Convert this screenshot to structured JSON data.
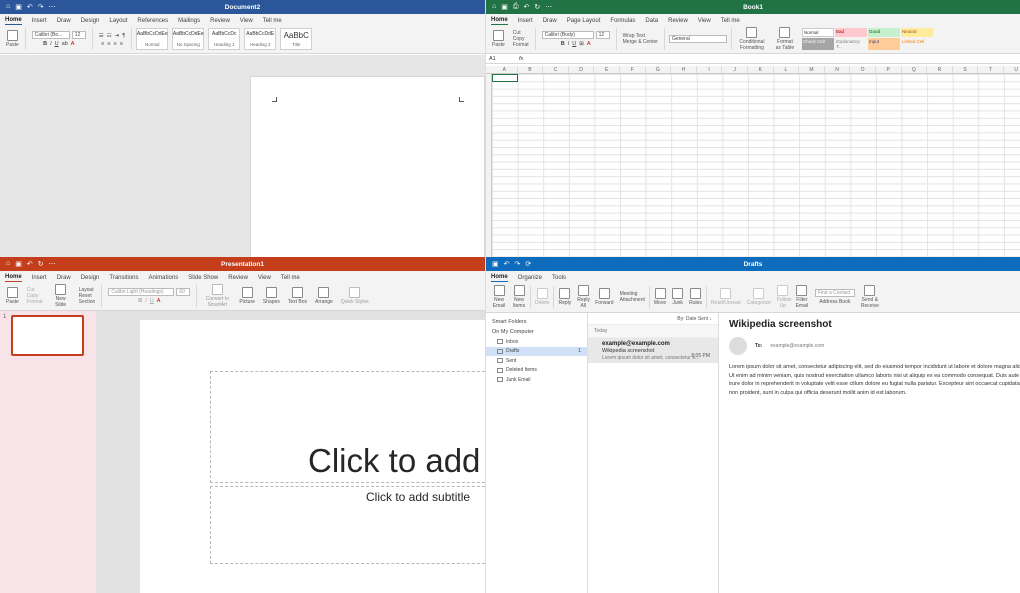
{
  "word": {
    "title": "Document2",
    "tabs": [
      "Home",
      "Insert",
      "Draw",
      "Design",
      "Layout",
      "References",
      "Mailings",
      "Review",
      "View",
      "Tell me"
    ],
    "paste": "Paste",
    "font": "Calibri (Bo...",
    "size": "12",
    "styles": [
      {
        "sample": "AaBbCcDdEe",
        "name": "Normal"
      },
      {
        "sample": "AaBbCcDdEe",
        "name": "No Spacing"
      },
      {
        "sample": "AaBbCcDc",
        "name": "Heading 1"
      },
      {
        "sample": "AaBbCcDdE",
        "name": "Heading 2"
      },
      {
        "sample": "AaBbC",
        "name": "Title"
      }
    ]
  },
  "excel": {
    "title": "Book1",
    "tabs": [
      "Home",
      "Insert",
      "Draw",
      "Page Layout",
      "Formulas",
      "Data",
      "Review",
      "View",
      "Tell me"
    ],
    "paste": "Paste",
    "cut": "Cut",
    "copy": "Copy",
    "format": "Format",
    "font": "Calibri (Body)",
    "size": "12",
    "wrap": "Wrap Text",
    "merge": "Merge & Center",
    "number_format": "General",
    "cond": "Conditional Formatting",
    "table": "Format as Table",
    "cell_styles": [
      "Normal",
      "Bad",
      "Good",
      "Neutral",
      "Check Cell",
      "Explanatory T...",
      "Input",
      "Linked Cell"
    ],
    "name_box": "A1",
    "fx": "fx",
    "columns": [
      "A",
      "B",
      "C",
      "D",
      "E",
      "F",
      "G",
      "H",
      "I",
      "J",
      "K",
      "L",
      "M",
      "N",
      "O",
      "P",
      "Q",
      "R",
      "S",
      "T",
      "U"
    ]
  },
  "ppt": {
    "title": "Presentation1",
    "tabs": [
      "Home",
      "Insert",
      "Draw",
      "Design",
      "Transitions",
      "Animations",
      "Slide Show",
      "Review",
      "View",
      "Tell me"
    ],
    "paste": "Paste",
    "cut": "Cut",
    "copy": "Copy",
    "format": "Format",
    "new_slide": "New Slide",
    "layout": "Layout",
    "reset": "Reset",
    "section": "Section",
    "font": "Calibri Light (Headings)",
    "size": "60",
    "tools": [
      "Convert to SmartArt",
      "Picture",
      "Shapes",
      "Text Box",
      "Arrange",
      "Quick Styles"
    ],
    "slide_num": "1",
    "title_placeholder": "Click to add title",
    "subtitle_placeholder": "Click to add subtitle"
  },
  "outlook": {
    "title": "Drafts",
    "tabs": [
      "Home",
      "Organize",
      "Tools"
    ],
    "buttons": [
      "New Email",
      "New Items",
      "Delete",
      "Reply",
      "Reply All",
      "Forward",
      "Meeting",
      "Attachment",
      "Move",
      "Junk",
      "Rules",
      "Read/Unread",
      "Categorize",
      "Follow Up",
      "Filter Email",
      "Find a Contact",
      "Address Book",
      "Send & Receive"
    ],
    "smart_folders": "Smart Folders",
    "on_my_computer": "On My Computer",
    "folders": [
      {
        "name": "Inbox",
        "count": ""
      },
      {
        "name": "Drafts",
        "count": "1"
      },
      {
        "name": "Sent",
        "count": ""
      },
      {
        "name": "Deleted Items",
        "count": ""
      },
      {
        "name": "Junk Email",
        "count": ""
      }
    ],
    "sort": "By: Date Sent",
    "group": "Today",
    "message": {
      "from": "example@example.com",
      "subject": "Wikipedia screenshot",
      "time": "8:05 PM",
      "preview": "Lorem ipsum dolor sit amet, consectetur a..."
    },
    "reading": {
      "subject": "Wikipedia screenshot",
      "to_label": "To:",
      "to": "example@example.com",
      "body": "Lorem ipsum dolor sit amet, consectetur adipiscing elit, sed do eiusmod tempor incididunt ut labore et dolore magna aliqua. Ut enim ad minim veniam, quis nostrud exercitation ullamco laboris nisi ut aliquip ex ea commodo consequat. Duis aute irure dolor in reprehenderit in voluptate velit esse cillum dolore eu fugiat nulla pariatur. Excepteur sint occaecat cupidatat non proident, sunt in culpa qui officia deserunt mollit anim id est laborum."
    }
  }
}
